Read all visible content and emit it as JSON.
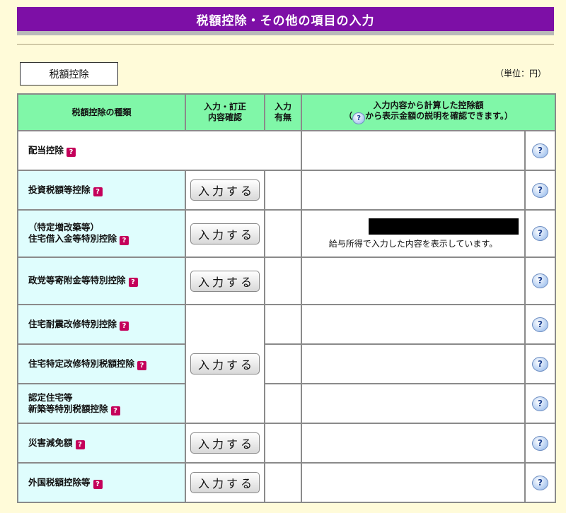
{
  "page": {
    "title": "税額控除・その他の項目の入力",
    "section_label": "税額控除",
    "unit": "（単位：円）"
  },
  "table": {
    "headers": {
      "kind": "税額控除の種類",
      "confirm_line1": "入力・訂正",
      "confirm_line2": "内容確認",
      "has_line1": "入力",
      "has_line2": "有無",
      "amount_line1": "入力内容から計算した控除額",
      "amount_line2_open": "（",
      "amount_line2_rest": "から表示金額の説明を確認できます。）"
    },
    "input_button_label": "入力する",
    "rows": [
      {
        "label_line1": "配当控除",
        "label_line2": ""
      },
      {
        "label_line1": "投資税額等控除",
        "label_line2": ""
      },
      {
        "label_line1": "（特定増改築等）",
        "label_line2": "住宅借入金等特別控除",
        "note": "給与所得で入力した内容を表示しています。"
      },
      {
        "label_line1": "政党等寄附金等特別控除",
        "label_line2": ""
      },
      {
        "label_line1": "住宅耐震改修特別控除",
        "label_line2": ""
      },
      {
        "label_line1": "住宅特定改修特別税額控除",
        "label_line2": ""
      },
      {
        "label_line1": "認定住宅等",
        "label_line2": "新築等特別税額控除"
      },
      {
        "label_line1": "災害減免額",
        "label_line2": ""
      },
      {
        "label_line1": "外国税額控除等",
        "label_line2": ""
      }
    ]
  },
  "icons": {
    "help_mark": "?",
    "help_bubble": "?"
  },
  "colors": {
    "title_bg": "#7d0fa6",
    "header_bg": "#80f7a8",
    "row_label_bg": "#dffdfd",
    "page_bg": "#fffbd9",
    "help_mark": "#c4005a"
  }
}
